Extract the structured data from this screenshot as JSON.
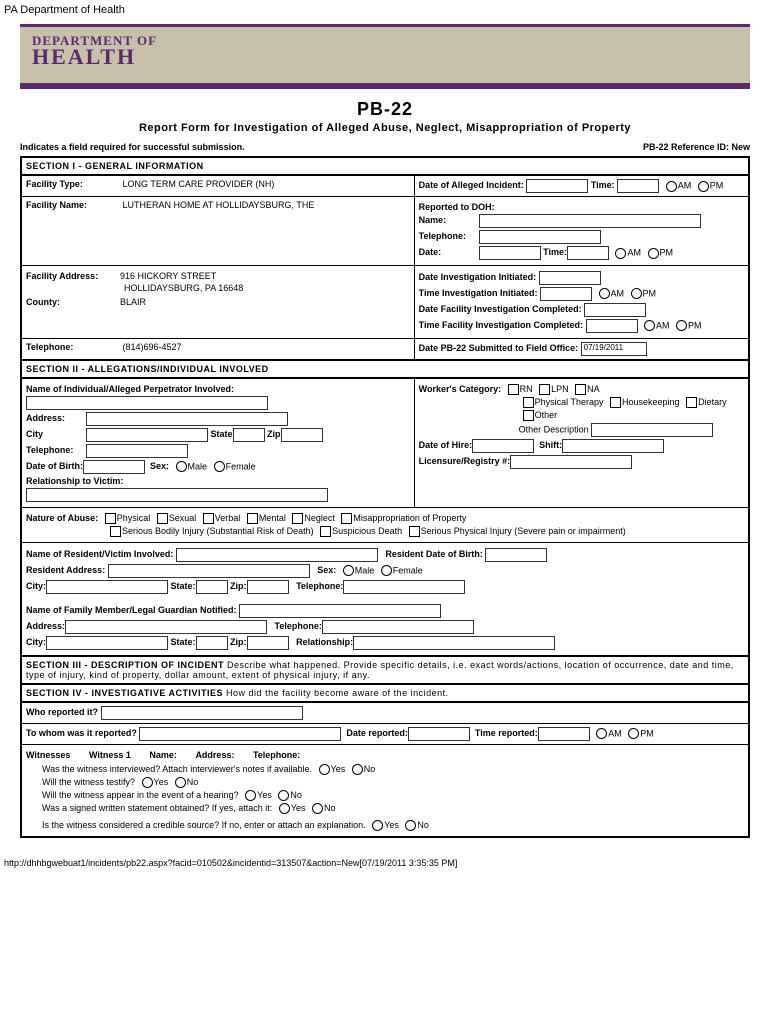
{
  "page_header": "PA Department of Health",
  "logo": {
    "line1": "DEPARTMENT OF",
    "line2": "HEALTH"
  },
  "form_code": "PB-22",
  "form_title": "Report Form for Investigation of Alleged Abuse, Neglect, Misappropriation of Property",
  "required_note": "Indicates a field required for successful submission.",
  "reference_id": "PB-22 Reference ID: New",
  "s1": {
    "header": "SECTION I - GENERAL INFORMATION",
    "facility_type_lbl": "Facility Type:",
    "facility_type_val": "LONG TERM CARE PROVIDER (NH)",
    "date_incident_lbl": "Date of Alleged Incident:",
    "time_lbl": "Time:",
    "am": "AM",
    "pm": "PM",
    "facility_name_lbl": "Facility Name:",
    "facility_name_val": "LUTHERAN HOME AT HOLLIDAYSBURG, THE",
    "reported_doh_lbl": "Reported to DOH:",
    "name_lbl": "Name:",
    "telephone_lbl": "Telephone:",
    "date_lbl": "Date:",
    "facility_addr_lbl": "Facility Address:",
    "facility_addr_val1": "916 HICKORY STREET",
    "facility_addr_val2": "HOLLIDAYSBURG, PA 16648",
    "county_lbl": "County:",
    "county_val": "BLAIR",
    "date_inv_init_lbl": "Date Investigation Initiated:",
    "time_inv_init_lbl": "Time Investigation Initiated:",
    "date_fac_inv_lbl": "Date Facility Investigation Completed:",
    "time_fac_inv_lbl": "Time Facility Investigation Completed:",
    "tel_lbl": "Telephone:",
    "tel_val": "(814)696-4527",
    "date_submitted_lbl": "Date PB-22 Submitted to Field Office:",
    "date_submitted_val": "07/19/2011"
  },
  "s2": {
    "header": "SECTION II - ALLEGATIONS/INDIVIDUAL INVOLVED",
    "name_perp_lbl": "Name of Individual/Alleged Perpetrator Involved:",
    "worker_cat_lbl": "Worker's Category:",
    "rn": "RN",
    "lpn": "LPN",
    "na": "NA",
    "pt": "Physical Therapy",
    "hk": "Housekeeping",
    "diet": "Dietary",
    "other": "Other",
    "other_desc_lbl": "Other Description",
    "address_lbl": "Address:",
    "city_lbl": "City",
    "state_lbl": "State",
    "zip_lbl": "Zip",
    "date_hire_lbl": "Date of Hire:",
    "shift_lbl": "Shift:",
    "tel_lbl": "Telephone:",
    "lic_reg_lbl": "Licensure/Registry #:",
    "dob_lbl": "Date of Birth:",
    "sex_lbl": "Sex:",
    "male": "Male",
    "female": "Female",
    "rel_victim_lbl": "Relationship to Victim:",
    "nature_lbl": "Nature of Abuse:",
    "phys": "Physical",
    "sex": "Sexual",
    "verb": "Verbal",
    "mental": "Mental",
    "neglect": "Neglect",
    "misapp": "Misappropriation of Property",
    "sbi": "Serious Bodily Injury (Substantial Risk of Death)",
    "susp": "Suspicious Death",
    "spi": "Serious Physical Injury (Severe pain or impairment)",
    "name_victim_lbl": "Name of Resident/Victim Involved:",
    "res_dob_lbl": "Resident Date of Birth:",
    "res_addr_lbl": "Resident Address:",
    "city2_lbl": "City:",
    "state2_lbl": "State:",
    "zip2_lbl": "Zip:",
    "name_fam_lbl": "Name of Family Member/Legal Guardian Notified:",
    "relationship_lbl": "Relationship:"
  },
  "s3": {
    "header": "SECTION III - DESCRIPTION OF INCIDENT",
    "desc": "Describe what happened. Provide specific details, i.e. exact words/actions, location of occurrence, date and time, type of injury, kind of property, dollar amount, extent of physical injury, if any."
  },
  "s4": {
    "header": "SECTION IV - INVESTIGATIVE ACTIVITIES",
    "desc": "How did the facility become aware of the incident.",
    "who_lbl": "Who reported it?",
    "towhom_lbl": "To whom was it reported?",
    "date_rep_lbl": "Date reported:",
    "time_rep_lbl": "Time reported:",
    "am": "AM",
    "pm": "PM",
    "witnesses_lbl": "Witnesses",
    "w1_lbl": "Witness 1",
    "name_lbl": "Name:",
    "addr_lbl": "Address:",
    "tel_lbl": "Telephone:",
    "q1": "Was the witness interviewed? Attach interviewer's notes if available.",
    "q2": "Will the witness testify?",
    "q3": "Will the witness appear in the event of a hearing?",
    "q4": "Was a signed written statement obtained? If yes, attach it:",
    "q5": "Is the witness considered a credible source? If no, enter or attach an explanation.",
    "yes": "Yes",
    "no": "No"
  },
  "footer_url": "http://dhhbgwebuat1/incidents/pb22.aspx?facid=010502&incidentid=313507&action=New[07/19/2011 3:35:35 PM]"
}
